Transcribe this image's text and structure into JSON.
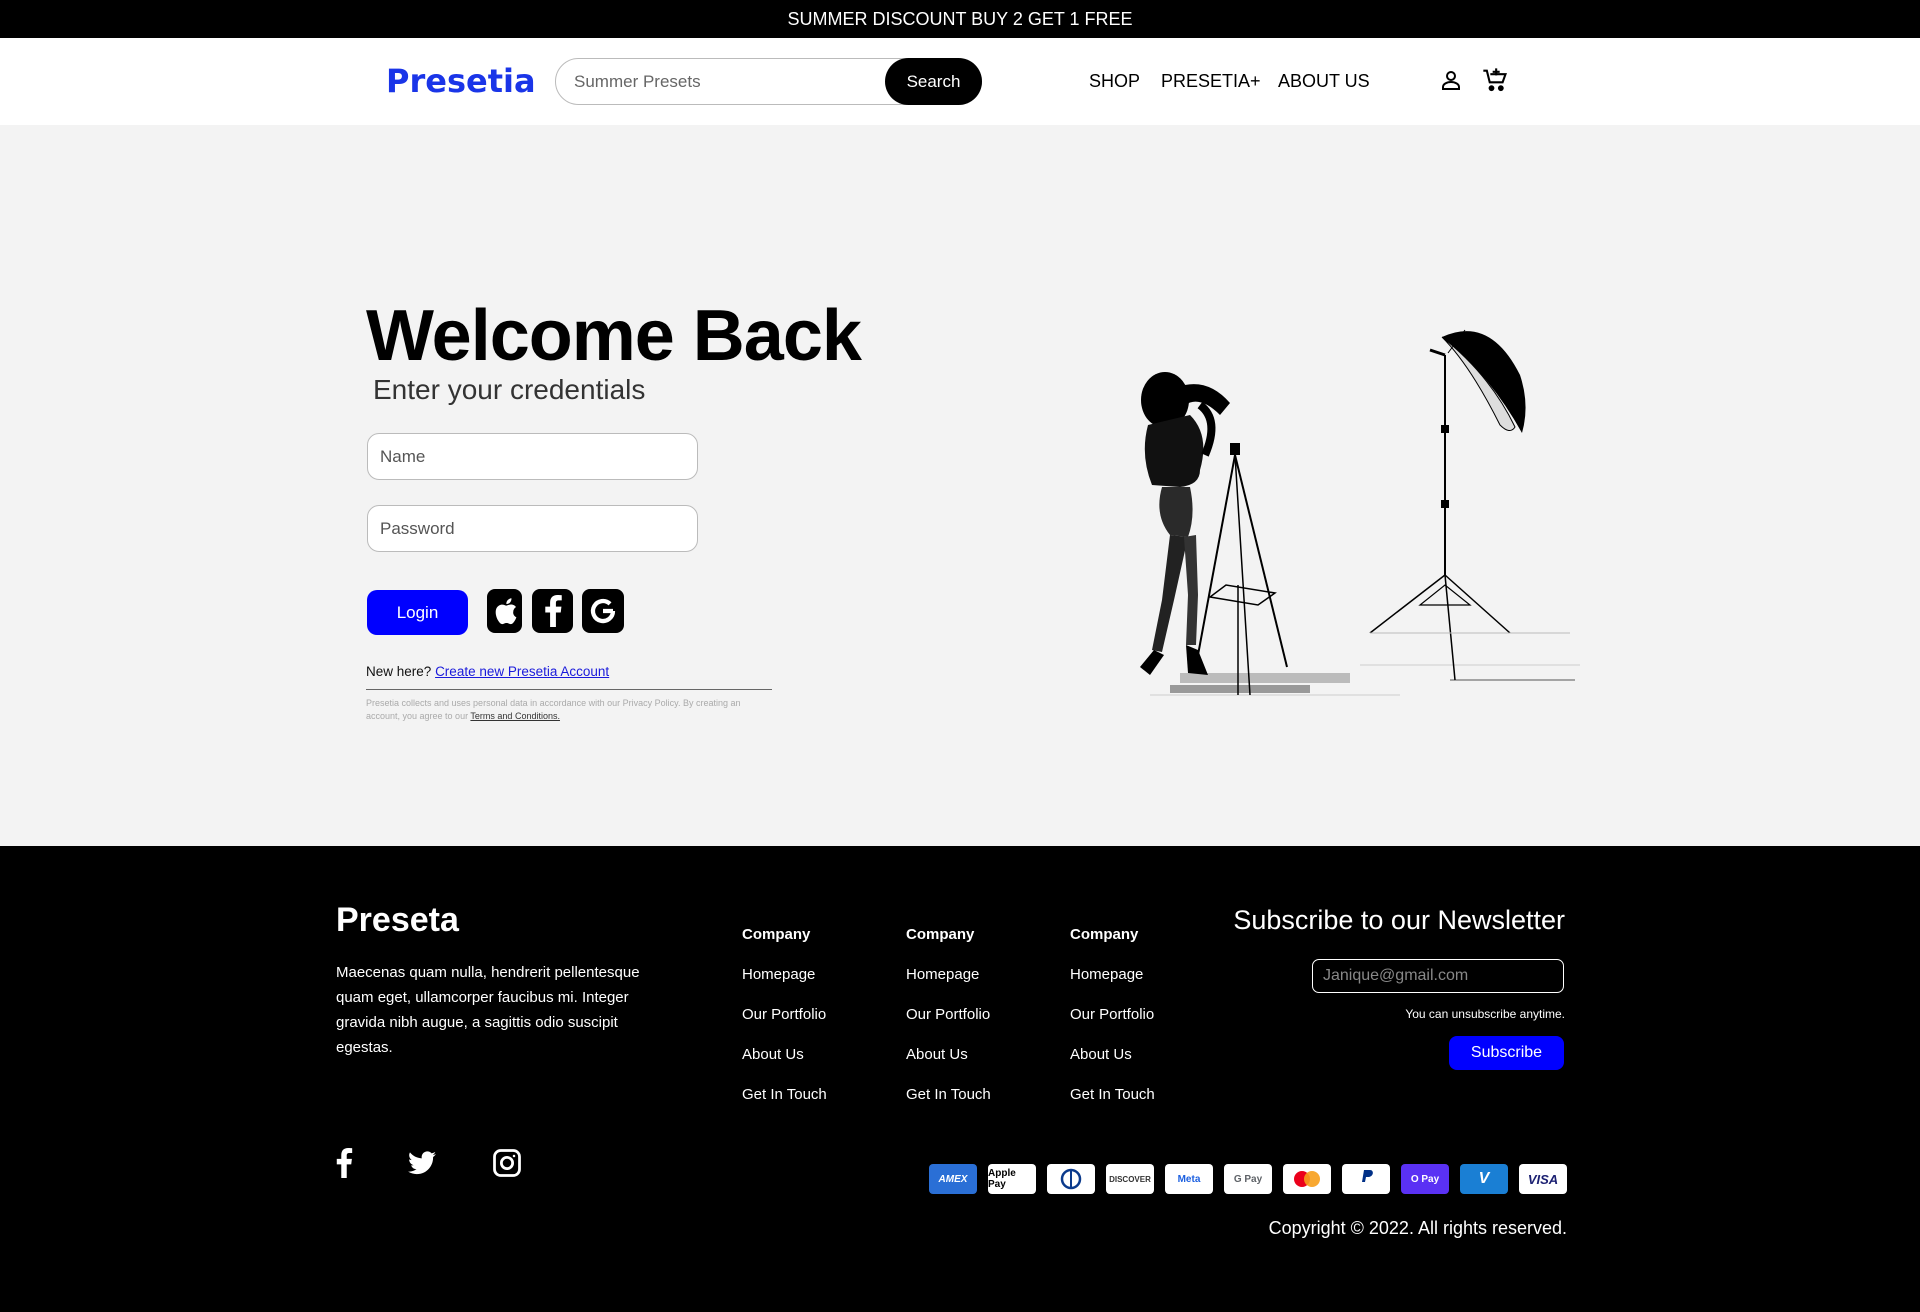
{
  "promo": {
    "text": "SUMMER DISCOUNT BUY 2 GET 1 FREE"
  },
  "header": {
    "logo": "Presetia",
    "search": {
      "placeholder": "Summer Presets",
      "button": "Search"
    },
    "nav": [
      "SHOP",
      "PRESETIA+",
      "ABOUT US"
    ],
    "icons": {
      "account": "person-icon",
      "cart": "cart-icon"
    }
  },
  "login": {
    "title": "Welcome Back",
    "subtitle": "Enter your credentials",
    "name_placeholder": "Name",
    "password_placeholder": "Password",
    "login_button": "Login",
    "social": [
      "apple-icon",
      "facebook-icon",
      "google-icon"
    ],
    "new_here": "New here?",
    "create_link": "Create new Presetia Account",
    "legal_text": "Presetia collects and uses personal data in accordance with our Privacy Policy. By creating an account, you agree to our",
    "terms_link": "Terms and Conditions.",
    "accent_color": "#0000ff"
  },
  "footer": {
    "logo": "Preseta",
    "description": "Maecenas quam nulla, hendrerit pellentesque quam eget, ullamcorper faucibus mi. Integer gravida nibh augue, a sagittis odio suscipit egestas.",
    "columns": [
      {
        "heading": "Company",
        "links": [
          "Homepage",
          "Our Portfolio",
          "About Us",
          "Get In Touch"
        ]
      },
      {
        "heading": "Company",
        "links": [
          "Homepage",
          "Our Portfolio",
          "About Us",
          "Get In Touch"
        ]
      },
      {
        "heading": "Company",
        "links": [
          "Homepage",
          "Our Portfolio",
          "About Us",
          "Get In Touch"
        ]
      }
    ],
    "newsletter": {
      "title": "Subscribe to our Newsletter",
      "placeholder": "Janique@gmail.com",
      "note": "You can unsubscribe anytime.",
      "button": "Subscribe"
    },
    "social": [
      "facebook-icon",
      "twitter-icon",
      "instagram-icon"
    ],
    "payments": [
      "AMEX",
      "Apple Pay",
      "Diners",
      "DISCOVER",
      "Meta",
      "G Pay",
      "Mastercard",
      "PayPal",
      "O Pay",
      "V",
      "VISA"
    ],
    "copyright": "Copyright © 2022. All rights reserved."
  }
}
